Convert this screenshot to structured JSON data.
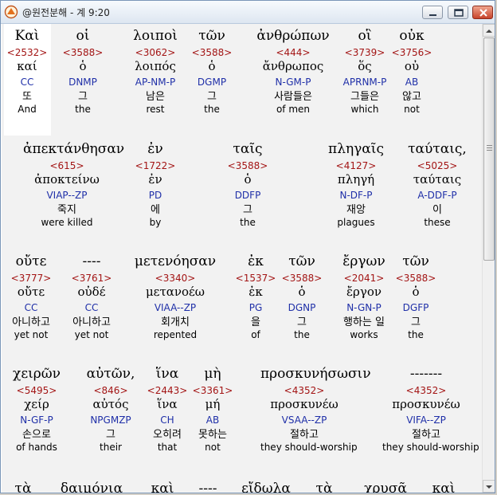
{
  "window": {
    "title": "@원전분해 - 계 9:20",
    "buttons": {
      "minimize": "minimize-icon",
      "maximize": "maximize-icon",
      "close": "close-icon"
    }
  },
  "rows": [
    {
      "words": [
        {
          "greek": "Καὶ",
          "strong": "<2532>",
          "lemma": "καί",
          "parsing": "CC",
          "korean": "또",
          "english": "And"
        },
        {
          "greek": "οἱ",
          "strong": "<3588>",
          "lemma": "ὁ",
          "parsing": "DNMP",
          "korean": "그",
          "english": "the"
        },
        {
          "greek": "λοιποὶ",
          "strong": "<3062>",
          "lemma": "λοιπός",
          "parsing": "AP-NM-P",
          "korean": "남은",
          "english": "rest"
        },
        {
          "greek": "τῶν",
          "strong": "<3588>",
          "lemma": "ὁ",
          "parsing": "DGMP",
          "korean": "그",
          "english": "the"
        },
        {
          "greek": "ἀνθρώπων",
          "strong": "<444>",
          "lemma": "ἄνθρωπος",
          "parsing": "N-GM-P",
          "korean": "사람들은",
          "english": "of men"
        },
        {
          "greek": "οἳ",
          "strong": "<3739>",
          "lemma": "ὅς",
          "parsing": "APRNM-P",
          "korean": "그들은",
          "english": "which"
        },
        {
          "greek": "οὐκ",
          "strong": "<3756>",
          "lemma": "οὐ",
          "parsing": "AB",
          "korean": "않고",
          "english": "not"
        }
      ]
    },
    {
      "words": [
        {
          "greek": "ἀπεκτάνθησαν",
          "strong": "<615>",
          "lemma": "ἀποκτείνω",
          "parsing": "VIAP--ZP",
          "korean": "죽지",
          "english": "were killed"
        },
        {
          "greek": "ἐν",
          "strong": "<1722>",
          "lemma": "ἐν",
          "parsing": "PD",
          "korean": "에",
          "english": "by"
        },
        {
          "greek": "ταῖς",
          "strong": "<3588>",
          "lemma": "ὁ",
          "parsing": "DDFP",
          "korean": "그",
          "english": "the"
        },
        {
          "greek": "πληγαῖς",
          "strong": "<4127>",
          "lemma": "πληγή",
          "parsing": "N-DF-P",
          "korean": "재앙",
          "english": "plagues"
        },
        {
          "greek": "ταύταις,",
          "strong": "<5025>",
          "lemma": "ταύταις",
          "parsing": "A-DDF-P",
          "korean": "이",
          "english": "these"
        }
      ]
    },
    {
      "words": [
        {
          "greek": "οὔτε",
          "strong": "<3777>",
          "lemma": "οὔτε",
          "parsing": "CC",
          "korean": "아니하고",
          "english": "yet not"
        },
        {
          "greek": "----",
          "strong": "<3761>",
          "lemma": "οὐδέ",
          "parsing": "CC",
          "korean": "아니하고",
          "english": "yet not"
        },
        {
          "greek": "μετενόησαν",
          "strong": "<3340>",
          "lemma": "μετανοέω",
          "parsing": "VIAA--ZP",
          "korean": "회개치",
          "english": "repented"
        },
        {
          "greek": "ἐκ",
          "strong": "<1537>",
          "lemma": "ἐκ",
          "parsing": "PG",
          "korean": "을",
          "english": "of"
        },
        {
          "greek": "τῶν",
          "strong": "<3588>",
          "lemma": "ὁ",
          "parsing": "DGNP",
          "korean": "그",
          "english": "the"
        },
        {
          "greek": "ἔργων",
          "strong": "<2041>",
          "lemma": "ἔργον",
          "parsing": "N-GN-P",
          "korean": "행하는 일",
          "english": "works"
        },
        {
          "greek": "τῶν",
          "strong": "<3588>",
          "lemma": "ὁ",
          "parsing": "DGFP",
          "korean": "그",
          "english": "the"
        }
      ]
    },
    {
      "words": [
        {
          "greek": "χειρῶν",
          "strong": "<5495>",
          "lemma": "χείρ",
          "parsing": "N-GF-P",
          "korean": "손으로",
          "english": "of hands"
        },
        {
          "greek": "αὐτῶν,",
          "strong": "<846>",
          "lemma": "αὐτός",
          "parsing": "NPGMZP",
          "korean": "그",
          "english": "their"
        },
        {
          "greek": "ἵνα",
          "strong": "<2443>",
          "lemma": "ἵνα",
          "parsing": "CH",
          "korean": "오히려",
          "english": "that"
        },
        {
          "greek": "μὴ",
          "strong": "<3361>",
          "lemma": "μή",
          "parsing": "AB",
          "korean": "못하는",
          "english": "not"
        },
        {
          "greek": "προσκυνήσωσιν",
          "strong": "<4352>",
          "lemma": "προσκυνέω",
          "parsing": "VSAA--ZP",
          "korean": "절하고",
          "english": "they should-worship"
        },
        {
          "greek": "-------",
          "strong": "<4352>",
          "lemma": "προσκυνέω",
          "parsing": "VIFA--ZP",
          "korean": "절하고",
          "english": "they should-worship"
        }
      ]
    }
  ],
  "partial_row": [
    "τὰ",
    "δαιμόνια",
    "καὶ",
    "----",
    "εἴδωλα",
    "τὰ",
    "χρυσᾶ",
    "καὶ"
  ],
  "colors": {
    "strong": "#a31515",
    "parsing": "#1f2fa8",
    "text": "#000000",
    "highlight": "#ffffff",
    "background": "#f2f2f2"
  }
}
